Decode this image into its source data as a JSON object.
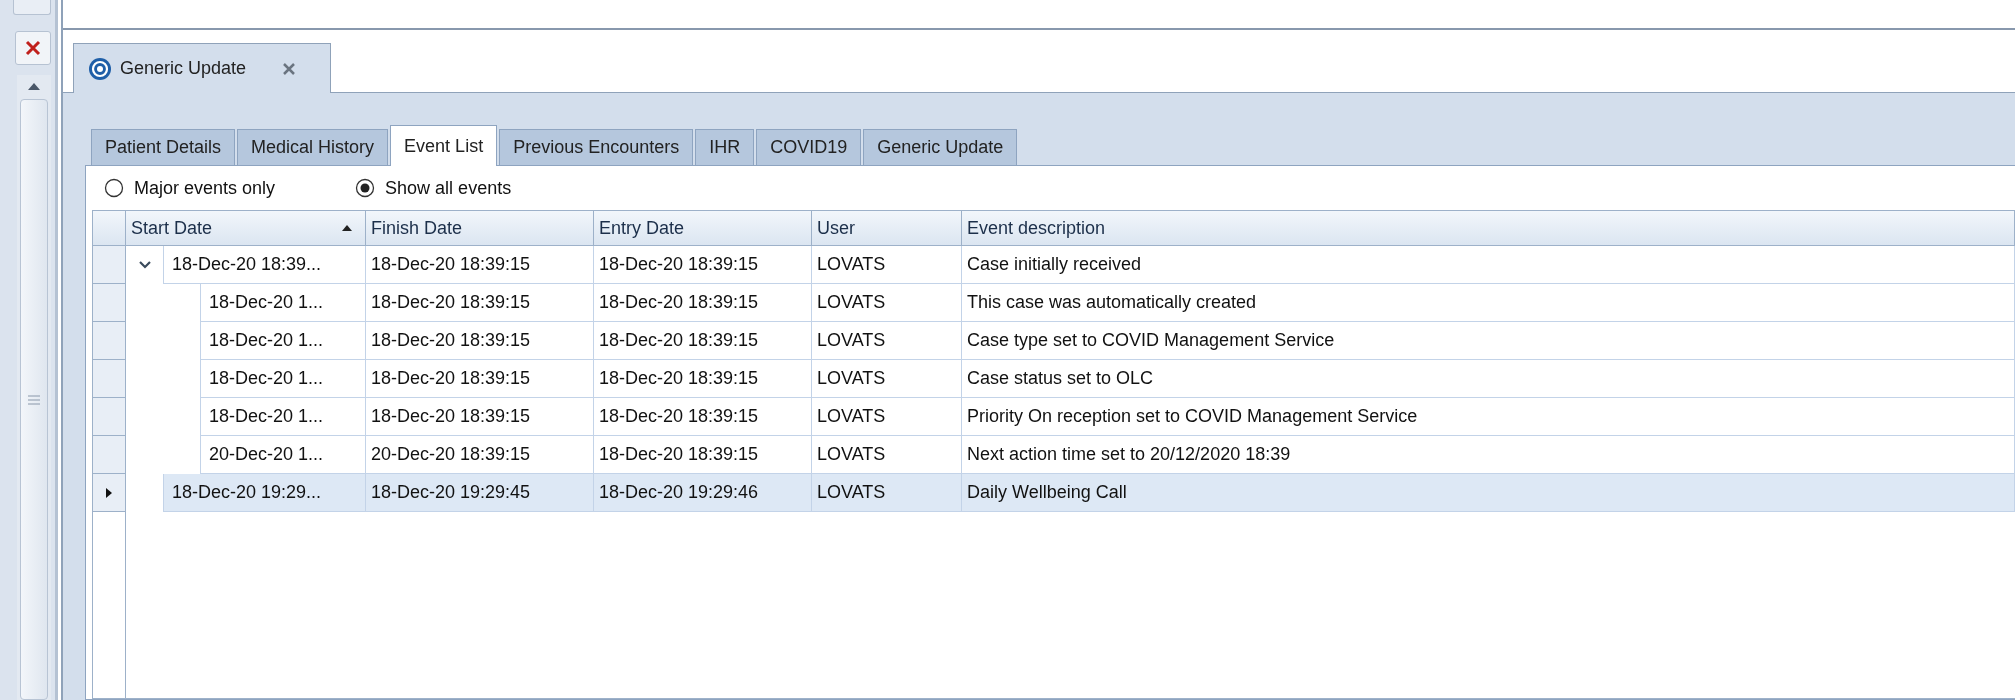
{
  "document_tab": {
    "title": "Generic Update",
    "selected": true
  },
  "tabs": [
    {
      "label": "Patient Details",
      "selected": false
    },
    {
      "label": "Medical History",
      "selected": false
    },
    {
      "label": "Event List",
      "selected": true
    },
    {
      "label": "Previous Encounters",
      "selected": false
    },
    {
      "label": "IHR",
      "selected": false
    },
    {
      "label": "COVID19",
      "selected": false
    },
    {
      "label": "Generic Update",
      "selected": false
    }
  ],
  "filter_options": [
    {
      "label": "Major events only",
      "selected": false
    },
    {
      "label": "Show all events",
      "selected": true
    }
  ],
  "table": {
    "columns": [
      {
        "label": "Start Date",
        "sorted_ascending": true
      },
      {
        "label": "Finish Date"
      },
      {
        "label": "Entry Date"
      },
      {
        "label": "User"
      },
      {
        "label": "Event description"
      }
    ],
    "rows": [
      {
        "cells": [
          "18-Dec-20 18:39...",
          "18-Dec-20 18:39:15",
          "18-Dec-20 18:39:15",
          "LOVATS",
          "Case initially received"
        ],
        "expanded": true,
        "selected": false,
        "children": [
          {
            "cells": [
              "18-Dec-20 1...",
              "18-Dec-20 18:39:15",
              "18-Dec-20 18:39:15",
              "LOVATS",
              "This case was automatically created"
            ],
            "selected": false
          },
          {
            "cells": [
              "18-Dec-20 1...",
              "18-Dec-20 18:39:15",
              "18-Dec-20 18:39:15",
              "LOVATS",
              "Case type set to COVID Management Service"
            ],
            "selected": false
          },
          {
            "cells": [
              "18-Dec-20 1...",
              "18-Dec-20 18:39:15",
              "18-Dec-20 18:39:15",
              "LOVATS",
              "Case status set to OLC"
            ],
            "selected": false
          },
          {
            "cells": [
              "18-Dec-20 1...",
              "18-Dec-20 18:39:15",
              "18-Dec-20 18:39:15",
              "LOVATS",
              "Priority On reception set to COVID Management Service"
            ],
            "selected": false
          },
          {
            "cells": [
              "20-Dec-20 1...",
              "20-Dec-20 18:39:15",
              "18-Dec-20 18:39:15",
              "LOVATS",
              "Next action time set to 20/12/2020 18:39"
            ],
            "selected": false
          }
        ]
      },
      {
        "cells": [
          "18-Dec-20 19:29...",
          "18-Dec-20 19:29:45",
          "18-Dec-20 19:29:46",
          "LOVATS",
          "Daily Wellbeing Call"
        ],
        "selected": true
      }
    ]
  }
}
